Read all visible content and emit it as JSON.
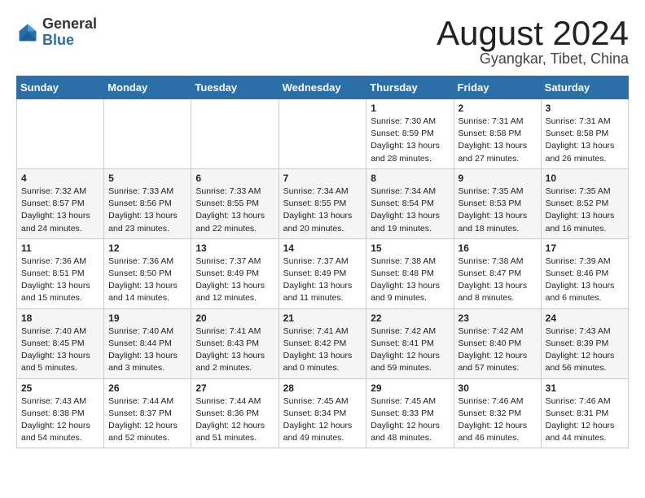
{
  "header": {
    "logo_general": "General",
    "logo_blue": "Blue",
    "month_title": "August 2024",
    "location": "Gyangkar, Tibet, China"
  },
  "days_of_week": [
    "Sunday",
    "Monday",
    "Tuesday",
    "Wednesday",
    "Thursday",
    "Friday",
    "Saturday"
  ],
  "weeks": [
    [
      {
        "day": "",
        "info": ""
      },
      {
        "day": "",
        "info": ""
      },
      {
        "day": "",
        "info": ""
      },
      {
        "day": "",
        "info": ""
      },
      {
        "day": "1",
        "info": "Sunrise: 7:30 AM\nSunset: 8:59 PM\nDaylight: 13 hours\nand 28 minutes."
      },
      {
        "day": "2",
        "info": "Sunrise: 7:31 AM\nSunset: 8:58 PM\nDaylight: 13 hours\nand 27 minutes."
      },
      {
        "day": "3",
        "info": "Sunrise: 7:31 AM\nSunset: 8:58 PM\nDaylight: 13 hours\nand 26 minutes."
      }
    ],
    [
      {
        "day": "4",
        "info": "Sunrise: 7:32 AM\nSunset: 8:57 PM\nDaylight: 13 hours\nand 24 minutes."
      },
      {
        "day": "5",
        "info": "Sunrise: 7:33 AM\nSunset: 8:56 PM\nDaylight: 13 hours\nand 23 minutes."
      },
      {
        "day": "6",
        "info": "Sunrise: 7:33 AM\nSunset: 8:55 PM\nDaylight: 13 hours\nand 22 minutes."
      },
      {
        "day": "7",
        "info": "Sunrise: 7:34 AM\nSunset: 8:55 PM\nDaylight: 13 hours\nand 20 minutes."
      },
      {
        "day": "8",
        "info": "Sunrise: 7:34 AM\nSunset: 8:54 PM\nDaylight: 13 hours\nand 19 minutes."
      },
      {
        "day": "9",
        "info": "Sunrise: 7:35 AM\nSunset: 8:53 PM\nDaylight: 13 hours\nand 18 minutes."
      },
      {
        "day": "10",
        "info": "Sunrise: 7:35 AM\nSunset: 8:52 PM\nDaylight: 13 hours\nand 16 minutes."
      }
    ],
    [
      {
        "day": "11",
        "info": "Sunrise: 7:36 AM\nSunset: 8:51 PM\nDaylight: 13 hours\nand 15 minutes."
      },
      {
        "day": "12",
        "info": "Sunrise: 7:36 AM\nSunset: 8:50 PM\nDaylight: 13 hours\nand 14 minutes."
      },
      {
        "day": "13",
        "info": "Sunrise: 7:37 AM\nSunset: 8:49 PM\nDaylight: 13 hours\nand 12 minutes."
      },
      {
        "day": "14",
        "info": "Sunrise: 7:37 AM\nSunset: 8:49 PM\nDaylight: 13 hours\nand 11 minutes."
      },
      {
        "day": "15",
        "info": "Sunrise: 7:38 AM\nSunset: 8:48 PM\nDaylight: 13 hours\nand 9 minutes."
      },
      {
        "day": "16",
        "info": "Sunrise: 7:38 AM\nSunset: 8:47 PM\nDaylight: 13 hours\nand 8 minutes."
      },
      {
        "day": "17",
        "info": "Sunrise: 7:39 AM\nSunset: 8:46 PM\nDaylight: 13 hours\nand 6 minutes."
      }
    ],
    [
      {
        "day": "18",
        "info": "Sunrise: 7:40 AM\nSunset: 8:45 PM\nDaylight: 13 hours\nand 5 minutes."
      },
      {
        "day": "19",
        "info": "Sunrise: 7:40 AM\nSunset: 8:44 PM\nDaylight: 13 hours\nand 3 minutes."
      },
      {
        "day": "20",
        "info": "Sunrise: 7:41 AM\nSunset: 8:43 PM\nDaylight: 13 hours\nand 2 minutes."
      },
      {
        "day": "21",
        "info": "Sunrise: 7:41 AM\nSunset: 8:42 PM\nDaylight: 13 hours\nand 0 minutes."
      },
      {
        "day": "22",
        "info": "Sunrise: 7:42 AM\nSunset: 8:41 PM\nDaylight: 12 hours\nand 59 minutes."
      },
      {
        "day": "23",
        "info": "Sunrise: 7:42 AM\nSunset: 8:40 PM\nDaylight: 12 hours\nand 57 minutes."
      },
      {
        "day": "24",
        "info": "Sunrise: 7:43 AM\nSunset: 8:39 PM\nDaylight: 12 hours\nand 56 minutes."
      }
    ],
    [
      {
        "day": "25",
        "info": "Sunrise: 7:43 AM\nSunset: 8:38 PM\nDaylight: 12 hours\nand 54 minutes."
      },
      {
        "day": "26",
        "info": "Sunrise: 7:44 AM\nSunset: 8:37 PM\nDaylight: 12 hours\nand 52 minutes."
      },
      {
        "day": "27",
        "info": "Sunrise: 7:44 AM\nSunset: 8:36 PM\nDaylight: 12 hours\nand 51 minutes."
      },
      {
        "day": "28",
        "info": "Sunrise: 7:45 AM\nSunset: 8:34 PM\nDaylight: 12 hours\nand 49 minutes."
      },
      {
        "day": "29",
        "info": "Sunrise: 7:45 AM\nSunset: 8:33 PM\nDaylight: 12 hours\nand 48 minutes."
      },
      {
        "day": "30",
        "info": "Sunrise: 7:46 AM\nSunset: 8:32 PM\nDaylight: 12 hours\nand 46 minutes."
      },
      {
        "day": "31",
        "info": "Sunrise: 7:46 AM\nSunset: 8:31 PM\nDaylight: 12 hours\nand 44 minutes."
      }
    ]
  ]
}
